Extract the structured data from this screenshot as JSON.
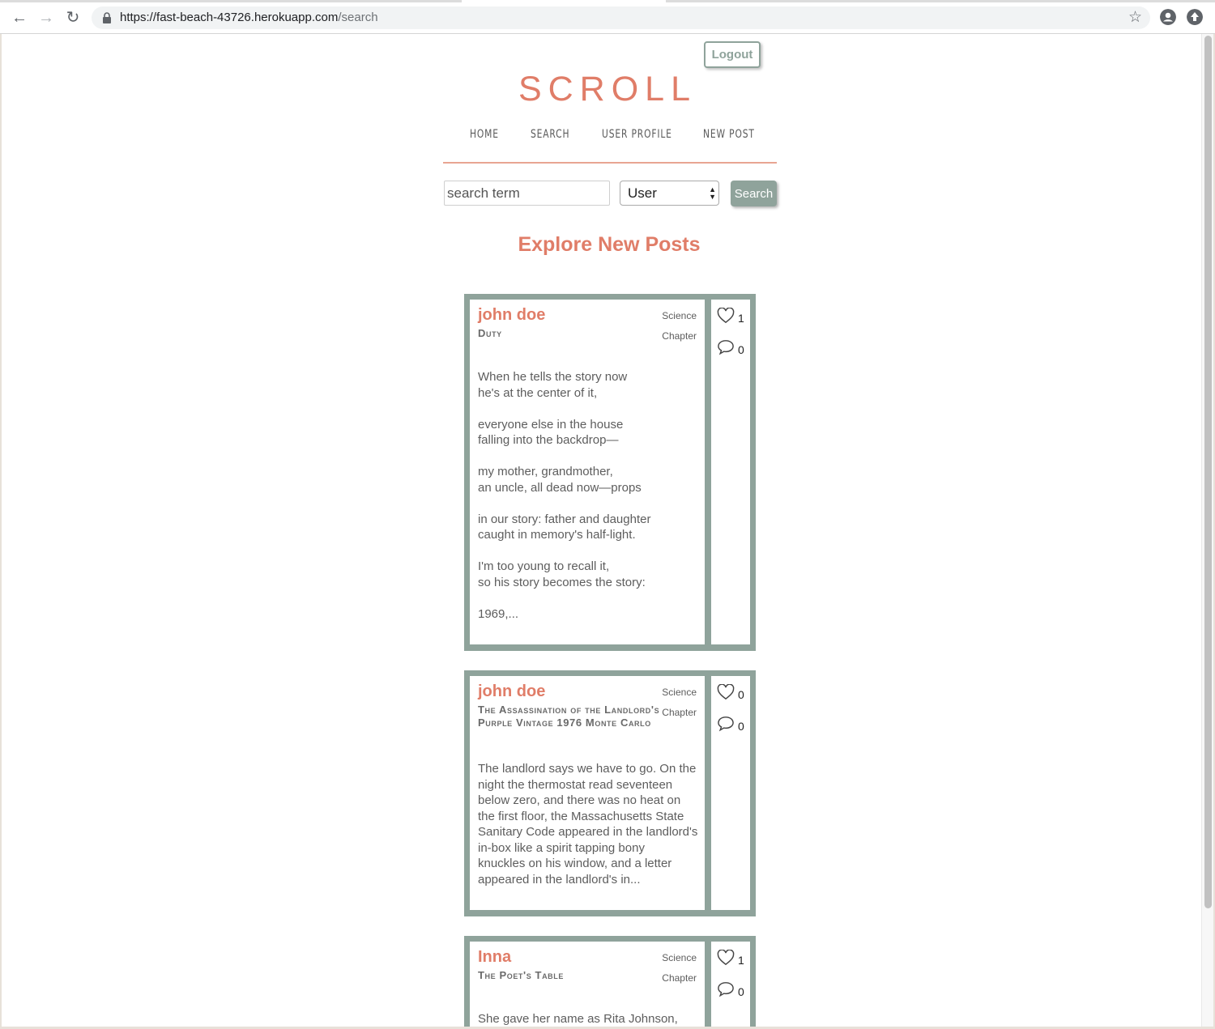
{
  "browser": {
    "url_host": "https://fast-beach-43726.herokuapp.com",
    "url_path": "/search"
  },
  "header": {
    "logout_label": "Logout",
    "site_title": "SCROLL",
    "nav": [
      "HOME",
      "SEARCH",
      "USER PROFILE",
      "NEW POST"
    ]
  },
  "search": {
    "placeholder": "search term",
    "type_value": "User",
    "button_label": "Search"
  },
  "explore_heading": "Explore New Posts",
  "posts": [
    {
      "author": "john doe",
      "title": "Duty",
      "genre": "Science",
      "type": "Chapter",
      "body": "When he tells the story now\nhe's at the center of it,\n\neveryone else in the house\nfalling into the backdrop—\n\nmy mother, grandmother,\nan uncle, all dead now—props\n\nin our story: father and daughter\ncaught in memory's half-light.\n\nI'm too young to recall it,\nso his story becomes the story:\n\n1969,...",
      "likes": "1",
      "comments": "0"
    },
    {
      "author": "john doe",
      "title": "The Assassination of the Landlord's Purple Vintage 1976 Monte Carlo",
      "genre": "Science",
      "type": "Chapter",
      "body": "The landlord says we have to go. On the\nnight the thermostat read seventeen\nbelow zero, and there was no heat on\nthe first floor, the Massachusetts State\nSanitary Code appeared in the landlord's\nin-box like a spirit tapping bony\nknuckles on his window, and a letter\nappeared in the landlord's in...",
      "likes": "0",
      "comments": "0"
    },
    {
      "author": "Inna",
      "title": "The Poet's Table",
      "genre": "Science",
      "type": "Chapter",
      "body": "She gave her name as Rita Johnson,",
      "likes": "1",
      "comments": "0"
    }
  ],
  "colors": {
    "accent": "#e07d68",
    "sage": "#8fa39b",
    "text": "#5d5d5d"
  },
  "icons": [
    "back-icon",
    "forward-icon",
    "reload-icon",
    "lock-icon",
    "star-icon",
    "profile-icon",
    "update-icon",
    "heart-icon",
    "comment-icon"
  ]
}
